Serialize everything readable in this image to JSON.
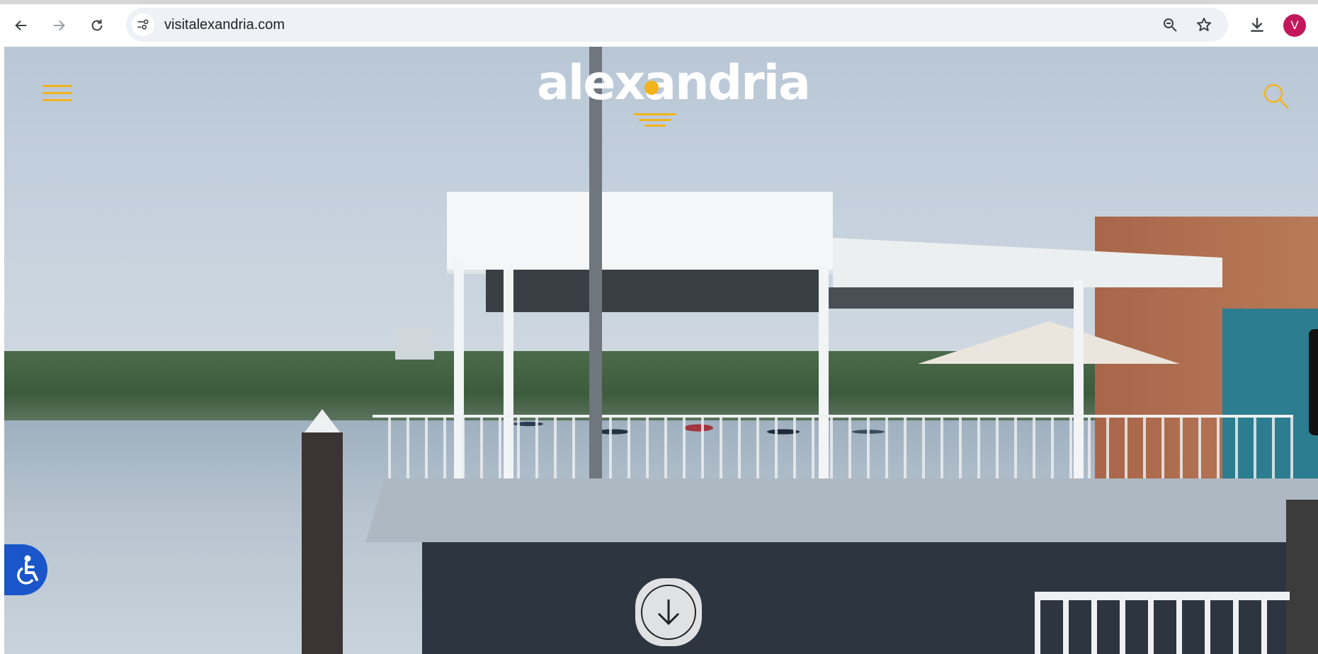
{
  "browser": {
    "url": "visitalexandria.com",
    "avatar_initial": "V",
    "accent": "#c2185b"
  },
  "site": {
    "logo_text": "alexandria",
    "brand_color": "#f2b31b",
    "a11y_color": "#1a56c9"
  },
  "icons": [
    "back-arrow-icon",
    "forward-arrow-icon",
    "reload-icon",
    "site-info-icon",
    "zoom-icon",
    "bookmark-star-icon",
    "download-icon",
    "hamburger-menu-icon",
    "search-icon",
    "accessibility-icon",
    "scroll-down-arrow-icon"
  ]
}
